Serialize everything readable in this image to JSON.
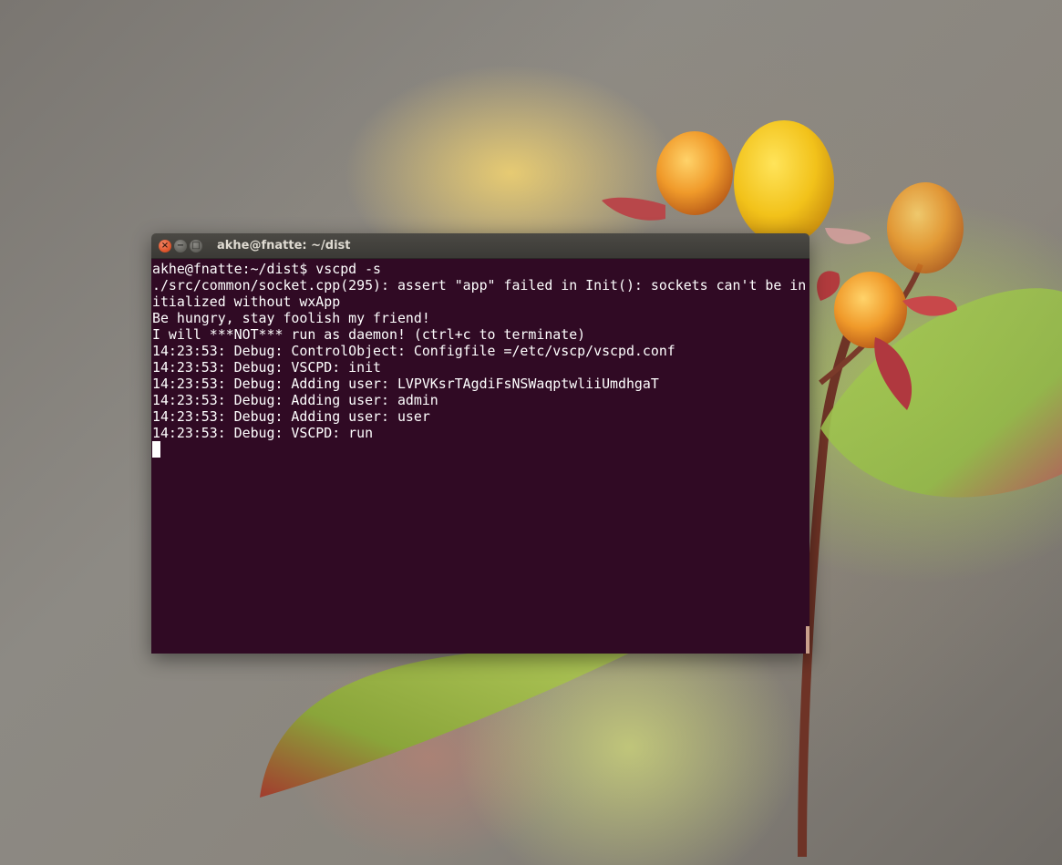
{
  "window": {
    "title": "akhe@fnatte: ~/dist",
    "controls": {
      "close_glyph": "×",
      "minimize_glyph": "−",
      "maximize_glyph": "□"
    }
  },
  "terminal": {
    "lines": [
      "akhe@fnatte:~/dist$ vscpd -s",
      "./src/common/socket.cpp(295): assert \"app\" failed in Init(): sockets can't be in",
      "itialized without wxApp",
      "Be hungry, stay foolish my friend!",
      "I will ***NOT*** run as daemon! (ctrl+c to terminate)",
      "14:23:53: Debug: ControlObject: Configfile =/etc/vscp/vscpd.conf",
      "14:23:53: Debug: VSCPD: init",
      "14:23:53: Debug: Adding user: LVPVKsrTAgdiFsNSWaqptwliiUmdhgaT",
      "14:23:53: Debug: Adding user: admin",
      "14:23:53: Debug: Adding user: user",
      "14:23:53: Debug: VSCPD: run"
    ],
    "background_color": "#300a24",
    "text_color": "#ffffff"
  },
  "icons": [
    "close-icon",
    "minimize-icon",
    "maximize-icon"
  ]
}
